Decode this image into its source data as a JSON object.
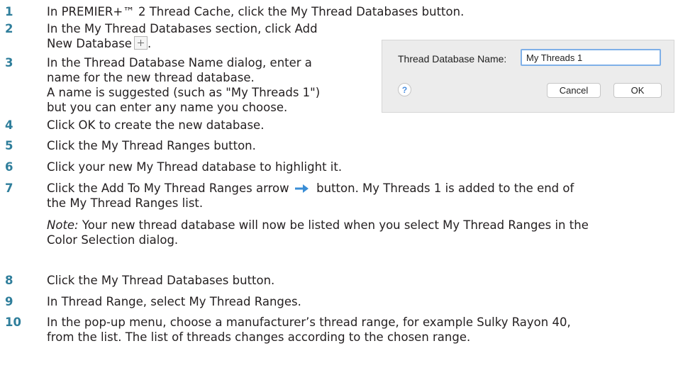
{
  "steps": [
    {
      "n": "1",
      "text": "In PREMIER+™ 2 Thread Cache, click the My Thread Databases button."
    },
    {
      "n": "2",
      "line1": "In the My Thread Databases section, click Add",
      "line2": "New Database"
    },
    {
      "n": "3",
      "line1": "In the Thread Database Name dialog, enter a",
      "line2": "name for the new thread database.",
      "line3": "A name is suggested (such as \"My Threads 1\")",
      "line4": "but you can enter any name you choose."
    },
    {
      "n": "4",
      "text": "Click OK to create the new database."
    },
    {
      "n": "5",
      "text": "Click the My Thread Ranges button."
    },
    {
      "n": "6",
      "text": "Click your new My Thread database to highlight it."
    },
    {
      "n": "7",
      "before": "Click the Add To My Thread Ranges arrow",
      "after": "button. My Threads 1 is added to the end of",
      "line2": "the My Thread Ranges list.",
      "note_label": "Note:",
      "note_line1": " Your new thread database will now be listed when you select My Thread Ranges in the",
      "note_line2": "Color Selection dialog."
    },
    {
      "n": "8",
      "text": "Click the My Thread Databases button."
    },
    {
      "n": "9",
      "text": "In Thread Range, select My Thread Ranges."
    },
    {
      "n": "10",
      "line1": "In the pop-up menu, choose a manufacturer’s thread range, for example Sulky Rayon 40,",
      "line2": "from the list. The list of threads changes according to the chosen range."
    }
  ],
  "icons": {
    "add": "plus-icon",
    "arrow": "arrow-right-icon",
    "help": "help-icon"
  },
  "colors": {
    "step_number": "#2f7e9b",
    "arrow": "#3a8ed6"
  },
  "dialog": {
    "label": "Thread Database Name:",
    "input_value": "My Threads 1",
    "help_glyph": "?",
    "cancel_label": "Cancel",
    "ok_label": "OK"
  }
}
